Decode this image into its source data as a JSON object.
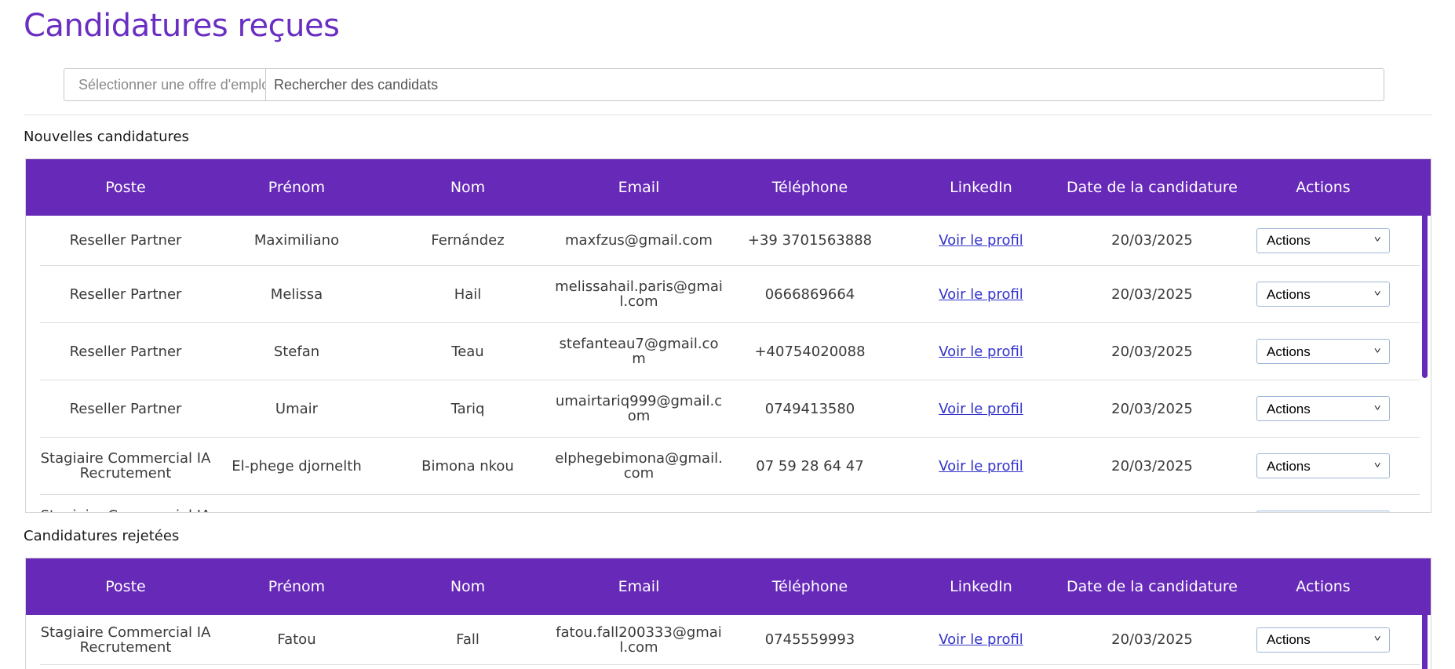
{
  "page": {
    "title": "Candidatures reçues"
  },
  "filters": {
    "job_select_placeholder": "Sélectionner une offre d'emploi",
    "search_placeholder": "Rechercher des candidats"
  },
  "columns": [
    "Poste",
    "Prénom",
    "Nom",
    "Email",
    "Téléphone",
    "LinkedIn",
    "Date de la candidature",
    "Actions"
  ],
  "new_applications": {
    "title": "Nouvelles candidatures",
    "rows": [
      {
        "poste": "Reseller Partner",
        "prenom": "Maximiliano",
        "nom": "Fernández",
        "email": "maxfzus@gmail.com",
        "telephone": "+39 3701563888",
        "linkedin": "Voir le profil",
        "date": "20/03/2025",
        "actions": "Actions"
      },
      {
        "poste": "Reseller Partner",
        "prenom": "Melissa",
        "nom": "Hail",
        "email": "melissahail.paris@gmail.com",
        "telephone": "0666869664",
        "linkedin": "Voir le profil",
        "date": "20/03/2025",
        "actions": "Actions"
      },
      {
        "poste": "Reseller Partner",
        "prenom": "Stefan",
        "nom": "Teau",
        "email": "stefanteau7@gmail.com",
        "telephone": "+40754020088",
        "linkedin": "Voir le profil",
        "date": "20/03/2025",
        "actions": "Actions"
      },
      {
        "poste": "Reseller Partner",
        "prenom": "Umair",
        "nom": "Tariq",
        "email": "umairtariq999@gmail.com",
        "telephone": "0749413580",
        "linkedin": "Voir le profil",
        "date": "20/03/2025",
        "actions": "Actions"
      },
      {
        "poste": "Stagiaire Commercial IA Recrutement",
        "prenom": "El-phege djornelth",
        "nom": "Bimona nkou",
        "email": "elphegebimona@gmail.com",
        "telephone": "07 59 28 64 47",
        "linkedin": "Voir le profil",
        "date": "20/03/2025",
        "actions": "Actions"
      },
      {
        "poste": "Stagiaire Commercial IA Recrutement",
        "prenom": "",
        "nom": "",
        "email": "",
        "telephone": "",
        "linkedin": "",
        "date": "",
        "actions": ""
      }
    ]
  },
  "rejected_applications": {
    "title": "Candidatures rejetées",
    "rows": [
      {
        "poste": "Stagiaire Commercial IA Recrutement",
        "prenom": "Fatou",
        "nom": "Fall",
        "email": "fatou.fall200333@gmail.com",
        "telephone": "0745559993",
        "linkedin": "Voir le profil",
        "date": "20/03/2025",
        "actions": "Actions"
      }
    ]
  },
  "colors": {
    "accent": "#6a2fc2",
    "header_bg": "#6629b8",
    "link": "#3333cc"
  },
  "icons": {
    "dropdown": "chevron-down-icon"
  }
}
